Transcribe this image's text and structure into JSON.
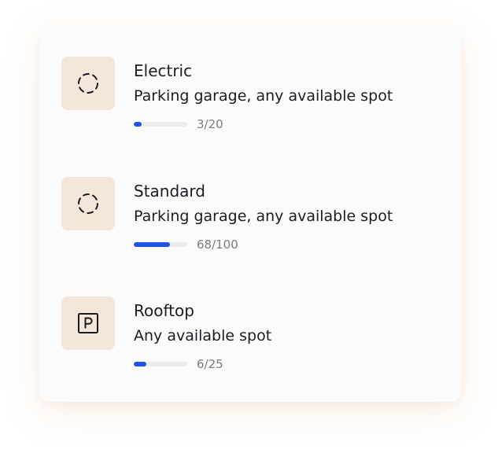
{
  "spots": [
    {
      "title": "Electric",
      "description": "Parking garage, any available spot",
      "count_label": "3/20",
      "occupied": 3,
      "capacity": 20,
      "icon": "dashed-circle-icon"
    },
    {
      "title": "Standard",
      "description": "Parking garage, any available spot",
      "count_label": "68/100",
      "occupied": 68,
      "capacity": 100,
      "icon": "dashed-circle-icon"
    },
    {
      "title": "Rooftop",
      "description": "Any available spot",
      "count_label": "6/25",
      "occupied": 6,
      "capacity": 25,
      "icon": "parking-sign-icon"
    }
  ],
  "colors": {
    "accent": "#1f54e3",
    "icon_tile": "#f5e6da",
    "track": "#ececec"
  }
}
